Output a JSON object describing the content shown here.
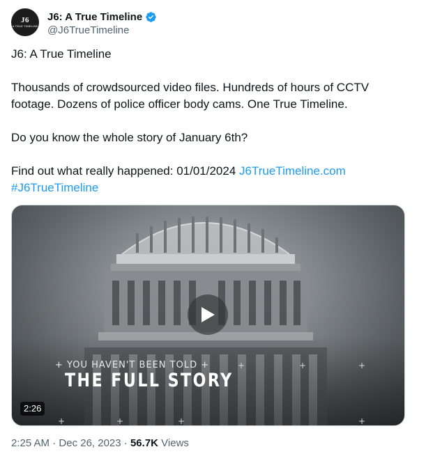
{
  "author": {
    "display_name": "J6: A True Timeline",
    "handle": "@J6TrueTimeline",
    "avatar_text": "J6",
    "avatar_subtext": "A TRUE TIMELINE"
  },
  "tweet": {
    "line1": "J6: A True Timeline",
    "line2": "Thousands of crowdsourced video files. Hundreds of hours of CCTV footage. Dozens of police officer body cams. One True Timeline.",
    "line3": "Do you know the whole story of January 6th?",
    "line4_text": "Find out what really happened: 01/01/2024 ",
    "line4_link": "J6TrueTimeline.com",
    "hashtag": "#J6TrueTimeline"
  },
  "media": {
    "overlay_subtitle": "+ YOU HAVEN'T BEEN TOLD +",
    "overlay_title": "THE FULL STORY",
    "duration": "2:26"
  },
  "meta": {
    "time": "2:25 AM",
    "separator1": " · ",
    "date": "Dec 26, 2023",
    "separator2": " · ",
    "views_count": "56.7K",
    "views_label": " Views"
  },
  "colors": {
    "link": "#1d9bf0",
    "verified": "#1d9bf0",
    "secondary_text": "#536471"
  }
}
